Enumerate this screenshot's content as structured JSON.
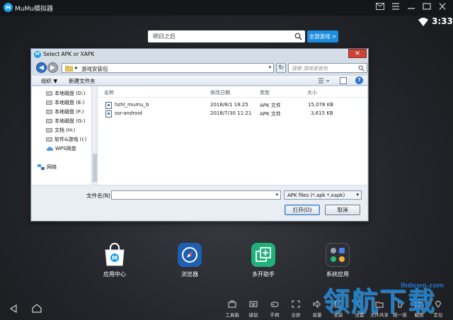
{
  "titlebar": {
    "title": "MuMu模拟器",
    "logo_text": "M",
    "controls": [
      "mail-icon",
      "menu-icon",
      "minimize-icon",
      "maximize-icon",
      "close-icon"
    ]
  },
  "status": {
    "time": "3:33"
  },
  "search": {
    "text": "明日之后",
    "all_games_label": "全部游戏 >"
  },
  "dialog": {
    "title": "Select APK or XAPK",
    "close_label": "✕",
    "address_path": "游戏安装包",
    "search_placeholder": "搜索 游戏安装包",
    "toolbar": {
      "organize": "组织 ▼",
      "new_folder": "新建文件夹",
      "help": "?"
    },
    "nav_items": [
      {
        "label": "本地磁盘 (D:)",
        "icon": "drive-icon"
      },
      {
        "label": "本地磁盘 (E:)",
        "icon": "drive-icon"
      },
      {
        "label": "本地磁盘 (F:)",
        "icon": "drive-icon"
      },
      {
        "label": "本地磁盘 (G:)",
        "icon": "drive-icon"
      },
      {
        "label": "文档 (H:)",
        "icon": "drive-icon"
      },
      {
        "label": "软件&游戏 (I:)",
        "icon": "drive-icon"
      },
      {
        "label": "WPS网盘",
        "icon": "cloud-icon"
      },
      {
        "label": "网络",
        "icon": "network-icon"
      }
    ],
    "columns": [
      "名称",
      "修改日期",
      "类型",
      "大小"
    ],
    "files": [
      {
        "name": "hzhl_mumu_b",
        "date": "2018/8/1 18:25",
        "type": "APK 文件",
        "size": "15,078 KB"
      },
      {
        "name": "ssr-android",
        "date": "2018/7/30 11:21",
        "type": "APK 文件",
        "size": "3,615 KB"
      }
    ],
    "filename_label": "文件名(N):",
    "filename_value": "",
    "filetype": "APK files (*.apk *.xapk)",
    "open_label": "打开(O)",
    "cancel_label": "取消"
  },
  "apps": [
    {
      "label": "应用中心",
      "color": "#ffffff"
    },
    {
      "label": "浏览器",
      "color": "#1f5fb0"
    },
    {
      "label": "多开助手",
      "color": "#22b07a"
    },
    {
      "label": "系统应用",
      "color": "#2c2f36"
    }
  ],
  "tools": [
    {
      "label": "工具箱",
      "icon": "toolbox-icon"
    },
    {
      "label": "键鼠",
      "icon": "keyboard-icon"
    },
    {
      "label": "手柄",
      "icon": "gamepad-icon"
    },
    {
      "label": "全屏",
      "icon": "fullscreen-icon"
    },
    {
      "label": "音量",
      "icon": "volume-icon"
    },
    {
      "label": "安装",
      "icon": "install-icon"
    },
    {
      "label": "设置",
      "icon": "settings-icon"
    },
    {
      "label": "文件共享",
      "icon": "share-icon"
    },
    {
      "label": "摇一摇",
      "icon": "shake-icon"
    },
    {
      "label": "截图",
      "icon": "screenshot-icon"
    },
    {
      "label": "定位",
      "icon": "location-icon"
    }
  ],
  "watermark": {
    "text": "领航下载",
    "url": "lhdown.com"
  }
}
